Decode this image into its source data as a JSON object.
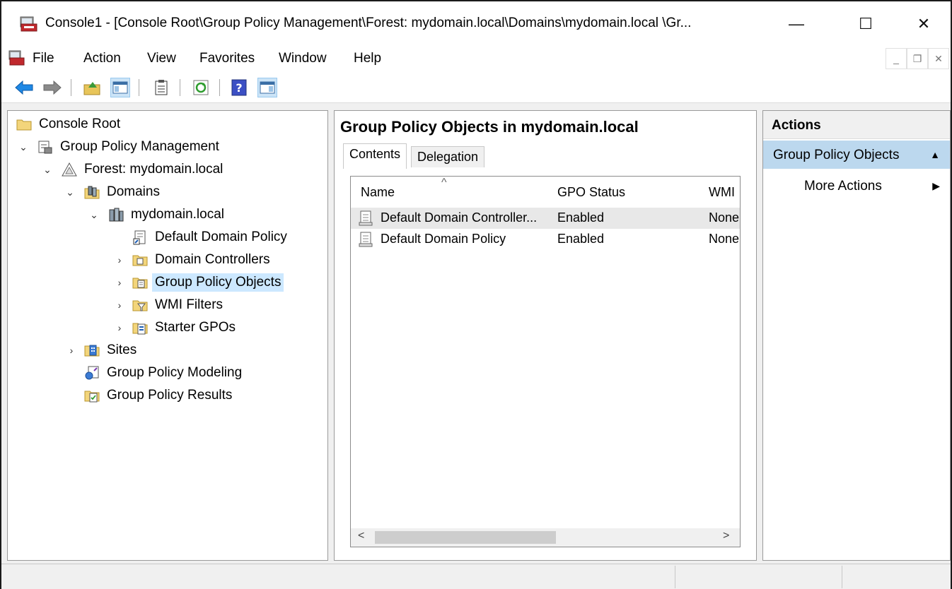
{
  "window": {
    "title": "Console1 - [Console Root\\Group Policy Management\\Forest: mydomain.local\\Domains\\mydomain.local \\Gr...",
    "minimize_glyph": "—",
    "maximize_glyph": "☐",
    "close_glyph": "✕"
  },
  "menu": {
    "items": [
      "File",
      "Action",
      "View",
      "Favorites",
      "Window",
      "Help"
    ]
  },
  "toolbar": {
    "buttons": [
      "back-icon",
      "forward-icon",
      "up-folder-icon",
      "show-hide-tree-icon",
      "export-list-icon",
      "refresh-icon",
      "help-icon",
      "show-hide-action-pane-icon"
    ]
  },
  "tree": {
    "items": [
      {
        "label": "Console Root",
        "icon": "folder-icon"
      },
      {
        "label": "Group Policy Management",
        "icon": "gpm-icon"
      },
      {
        "label": "Forest: mydomain.local",
        "icon": "forest-icon"
      },
      {
        "label": "Domains",
        "icon": "domains-icon"
      },
      {
        "label": "mydomain.local",
        "icon": "domain-icon"
      },
      {
        "label": "Default Domain Policy",
        "icon": "gpo-link-icon"
      },
      {
        "label": "Domain Controllers",
        "icon": "ou-icon"
      },
      {
        "label": "Group Policy Objects",
        "icon": "gpo-folder-icon"
      },
      {
        "label": "WMI Filters",
        "icon": "wmi-folder-icon"
      },
      {
        "label": "Starter GPOs",
        "icon": "starter-gpo-icon"
      },
      {
        "label": "Sites",
        "icon": "sites-icon"
      },
      {
        "label": "Group Policy Modeling",
        "icon": "modeling-icon"
      },
      {
        "label": "Group Policy Results",
        "icon": "results-icon"
      }
    ],
    "selected": "Group Policy Objects"
  },
  "center": {
    "title": "Group Policy Objects in mydomain.local",
    "tabs": [
      "Contents",
      "Delegation"
    ],
    "active_tab": "Contents",
    "columns": [
      "Name",
      "GPO Status",
      "WMI"
    ],
    "rows": [
      {
        "name": "Default Domain Controller...",
        "status": "Enabled",
        "wmi": "None"
      },
      {
        "name": "Default Domain Policy",
        "status": "Enabled",
        "wmi": "None"
      }
    ],
    "scroll_left": "<",
    "scroll_right": ">"
  },
  "actions": {
    "header": "Actions",
    "group": "Group Policy Objects",
    "items": [
      "More Actions"
    ]
  },
  "colors": {
    "selection": "#cce8ff",
    "action_group": "#bcd8ee",
    "row_highlight": "#e8e8e8"
  }
}
